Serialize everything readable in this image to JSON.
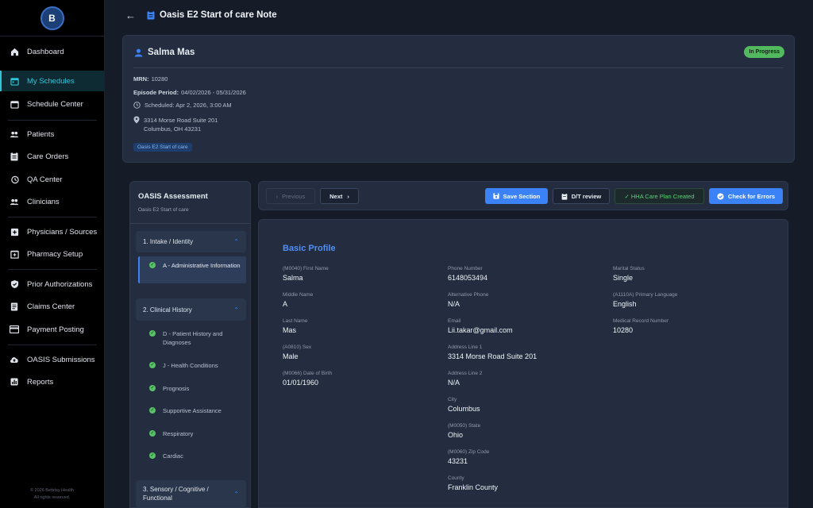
{
  "sidebar": {
    "logo_text": "B",
    "items": [
      {
        "label": "Dashboard",
        "icon": "home-icon"
      },
      {
        "label": "My Schedules",
        "icon": "calendar-icon",
        "active": true
      },
      {
        "label": "Schedule Center",
        "icon": "calendar-icon"
      },
      {
        "label": "Patients",
        "icon": "people-icon"
      },
      {
        "label": "Care Orders",
        "icon": "clipboard-icon"
      },
      {
        "label": "QA Center",
        "icon": "history-icon"
      },
      {
        "label": "Clinicians",
        "icon": "people-icon"
      },
      {
        "label": "Physicians / Sources",
        "icon": "plus-box-icon"
      },
      {
        "label": "Pharmacy Setup",
        "icon": "pharmacy-icon"
      },
      {
        "label": "Prior Authorizations",
        "icon": "shield-check-icon"
      },
      {
        "label": "Claims Center",
        "icon": "document-icon"
      },
      {
        "label": "Payment Posting",
        "icon": "card-icon"
      },
      {
        "label": "OASIS Submissions",
        "icon": "cloud-upload-icon"
      },
      {
        "label": "Reports",
        "icon": "bar-chart-icon"
      }
    ],
    "footer_line1": "© 2026 Bettrixy Health",
    "footer_line2": "All rights reserved."
  },
  "header": {
    "title": "Oasis E2 Start of care Note"
  },
  "patient": {
    "name": "Salma Mas",
    "status": "In Progress",
    "mrn_label": "MRN:",
    "mrn": "10280",
    "episode_label": "Episode Period:",
    "episode": "04/02/2026 - 05/31/2026",
    "scheduled": "Scheduled: Apr 2, 2026, 3:00 AM",
    "address_line1": "3314 Morse Road Suite 201",
    "address_line2": "Columbus, OH 43231",
    "tag": "Oasis E2 Start of care"
  },
  "assessment": {
    "title": "OASIS Assessment",
    "subtitle": "Oasis E2 Start of care",
    "sections": [
      {
        "label": "1. Intake / Identity",
        "items": [
          "A - Administrative Information"
        ]
      },
      {
        "label": "2. Clinical History",
        "items": [
          "D - Patient History and Diagnoses",
          "J - Health Conditions",
          "Prognosis",
          "Supportive Assistance",
          "Respiratory",
          "Cardiac"
        ]
      },
      {
        "label": "3. Sensory / Cognitive / Functional",
        "items": []
      }
    ]
  },
  "toolbar": {
    "previous": "Previous",
    "next": "Next",
    "save": "Save Section",
    "dt_review": "D/T review",
    "hha": "✓ HHA Care Plan Created",
    "check": "Check for Errors"
  },
  "form": {
    "section_title": "Basic Profile",
    "col1": [
      {
        "label": "(M0040) First Name",
        "value": "Salma"
      },
      {
        "label": "Middle Name",
        "value": "A"
      },
      {
        "label": "Last Name",
        "value": "Mas"
      },
      {
        "label": "(A0810) Sex",
        "value": "Male"
      },
      {
        "label": "(M0066) Date of Birth",
        "value": "01/01/1960"
      }
    ],
    "col2": [
      {
        "label": "Phone Number",
        "value": "6148053494"
      },
      {
        "label": "Alternative Phone",
        "value": "N/A"
      },
      {
        "label": "Email",
        "value": "Lii.takar@gmail.com"
      },
      {
        "label": "Address Line 1",
        "value": "3314 Morse Road Suite 201"
      },
      {
        "label": "Address Line 2",
        "value": "N/A"
      },
      {
        "label": "City",
        "value": "Columbus"
      },
      {
        "label": "(M0050) State",
        "value": "Ohio"
      },
      {
        "label": "(M0060) Zip Code",
        "value": "43231"
      },
      {
        "label": "County",
        "value": "Franklin County"
      }
    ],
    "col3": [
      {
        "label": "Marital Status",
        "value": "Single"
      },
      {
        "label": "(A1110A) Primary Language",
        "value": "English"
      },
      {
        "label": "Medical Record Number",
        "value": "10280"
      }
    ]
  },
  "colors": {
    "accent": "#3b82f6",
    "active_nav": "#2ec5d8",
    "success": "#52b95e"
  }
}
